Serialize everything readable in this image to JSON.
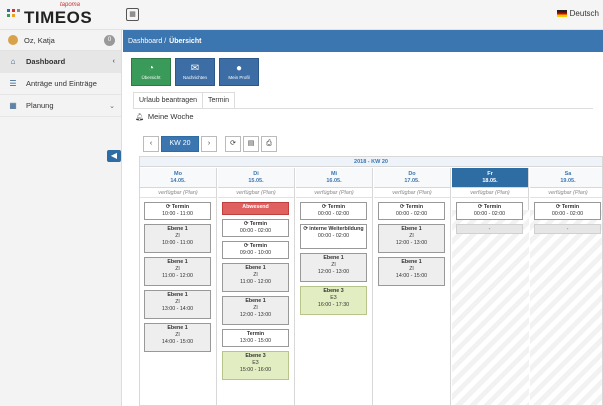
{
  "header": {
    "logo_small": "tapoma",
    "logo_brand": "TIMEOS",
    "language": "Deutsch"
  },
  "sidebar": {
    "user": {
      "name": "Oz, Katja",
      "badge": "0"
    },
    "items": [
      {
        "label": "Dashboard"
      },
      {
        "label": "Anträge und Einträge"
      },
      {
        "label": "Planung"
      }
    ]
  },
  "breadcrumb": {
    "root": "Dashboard /",
    "current": "Übersicht"
  },
  "tiles": [
    {
      "label": "Übersicht",
      "icon": "pie-chart-icon"
    },
    {
      "label": "Nachrichten",
      "icon": "envelope-icon"
    },
    {
      "label": "Mein Profil",
      "icon": "user-icon"
    }
  ],
  "tabs": [
    {
      "label": "Urlaub beantragen"
    },
    {
      "label": "Termin"
    }
  ],
  "section": {
    "title": "Meine Woche"
  },
  "toolbar": {
    "prev": "‹",
    "week": "KW 20",
    "next": "›",
    "refresh": "⟳",
    "doc": "▤",
    "print": "⎙"
  },
  "calendar": {
    "week_label": "2018 - KW 20",
    "days": [
      {
        "name": "Mo",
        "date": "14.05.",
        "avail": "verfügbar (Plan)",
        "today": false,
        "off": false
      },
      {
        "name": "Di",
        "date": "15.05.",
        "avail": "verfügbar (Plan)",
        "today": false,
        "off": false
      },
      {
        "name": "Mi",
        "date": "16.05.",
        "avail": "verfügbar (Plan)",
        "today": false,
        "off": false
      },
      {
        "name": "Do",
        "date": "17.05.",
        "avail": "verfügbar (Plan)",
        "today": false,
        "off": false
      },
      {
        "name": "Fr",
        "date": "18.05.",
        "avail": "verfügbar (Plan)",
        "today": true,
        "off": true
      },
      {
        "name": "Sa",
        "date": "19.05.",
        "avail": "verfügbar (Plan)",
        "today": false,
        "off": true
      }
    ],
    "events": [
      [
        {
          "type": "termin",
          "title": "⟳ Termin",
          "lines": [
            "10:00 - 11:00"
          ]
        },
        {
          "type": "ev",
          "title": "Ebene 1",
          "lines": [
            "Zl",
            "10:00 - 11:00"
          ]
        },
        {
          "type": "ev",
          "title": "Ebene 1",
          "lines": [
            "Zl",
            "11:00 - 12:00"
          ]
        },
        {
          "type": "ev",
          "title": "Ebene 1",
          "lines": [
            "Zl",
            "13:00 - 14:00"
          ]
        },
        {
          "type": "ev",
          "title": "Ebene 1",
          "lines": [
            "Zl",
            "14:00 - 15:00"
          ]
        }
      ],
      [
        {
          "type": "abs",
          "title": "Abwesend",
          "lines": []
        },
        {
          "type": "termin",
          "title": "⟳ Termin",
          "lines": [
            "00:00 - 02:00"
          ]
        },
        {
          "type": "termin",
          "title": "⟳ Termin",
          "lines": [
            "09:00 - 10:00"
          ]
        },
        {
          "type": "ev",
          "title": "Ebene 1",
          "lines": [
            "Zl",
            "11:00 - 12:00"
          ]
        },
        {
          "type": "ev",
          "title": "Ebene 1",
          "lines": [
            "Zl",
            "12:00 - 13:00"
          ]
        },
        {
          "type": "termin",
          "title": "Termin",
          "lines": [
            "13:00 - 15:00"
          ]
        },
        {
          "type": "e3",
          "title": "Ebene 3",
          "lines": [
            "E3",
            "15:00 - 16:00"
          ]
        }
      ],
      [
        {
          "type": "termin",
          "title": "⟳ Termin",
          "lines": [
            "00:00 - 02:00"
          ]
        },
        {
          "type": "termin",
          "title": "⟳ interne Weiterbildung",
          "lines": [
            "00:00 - 02:00"
          ]
        },
        {
          "type": "ev",
          "title": "Ebene 1",
          "lines": [
            "Zl",
            "12:00 - 13:00"
          ]
        },
        {
          "type": "e3",
          "title": "Ebene 3",
          "lines": [
            "E3",
            "16:00 - 17:30"
          ]
        }
      ],
      [
        {
          "type": "termin",
          "title": "⟳ Termin",
          "lines": [
            "00:00 - 02:00"
          ]
        },
        {
          "type": "ev",
          "title": "Ebene 1",
          "lines": [
            "Zl",
            "12:00 - 13:00"
          ]
        },
        {
          "type": "ev",
          "title": "Ebene 1",
          "lines": [
            "Zl",
            "14:00 - 15:00"
          ]
        }
      ],
      [
        {
          "type": "termin",
          "title": "⟳ Termin",
          "lines": [
            "00:00 - 02:00"
          ]
        },
        {
          "type": "gray",
          "title": "-",
          "lines": []
        }
      ],
      [
        {
          "type": "termin",
          "title": "⟳ Termin",
          "lines": [
            "00:00 - 02:00"
          ]
        },
        {
          "type": "gray",
          "title": "-",
          "lines": []
        }
      ]
    ]
  }
}
